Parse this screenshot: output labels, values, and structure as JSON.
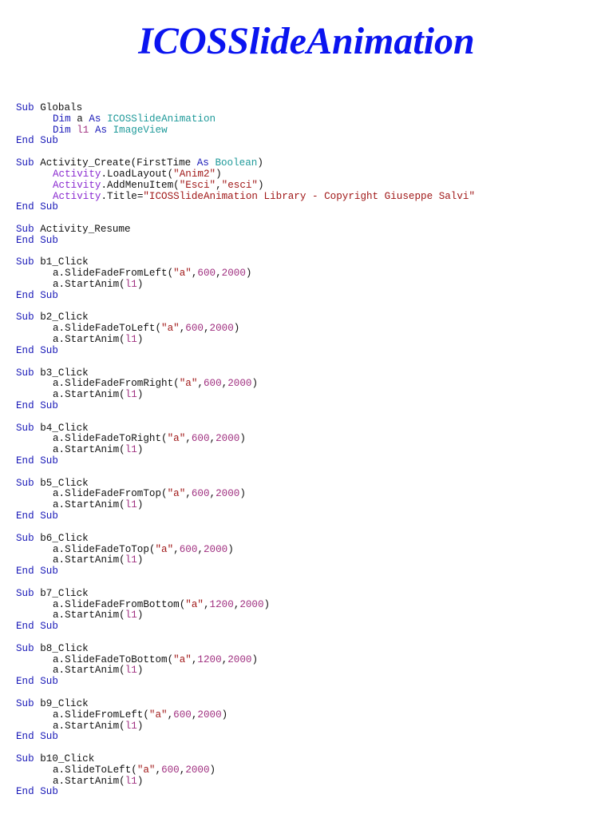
{
  "title": "ICOSSlideAnimation",
  "colors": {
    "title": "#0a14f0",
    "keyword": "#1a1ab8",
    "type": "#1f9a9a",
    "object": "#8a2ad0",
    "string": "#a01818",
    "number": "#a03080"
  },
  "code": [
    [
      0,
      [
        [
          "kw",
          "Sub"
        ],
        [
          "plain",
          " Globals"
        ]
      ]
    ],
    [
      1,
      [
        [
          "kw",
          "Dim"
        ],
        [
          "plain",
          " a "
        ],
        [
          "kw",
          "As"
        ],
        [
          "plain",
          " "
        ],
        [
          "type",
          "ICOSSlideAnimation"
        ]
      ]
    ],
    [
      1,
      [
        [
          "kw",
          "Dim"
        ],
        [
          "plain",
          " "
        ],
        [
          "num",
          "l1"
        ],
        [
          "plain",
          " "
        ],
        [
          "kw",
          "As"
        ],
        [
          "plain",
          " "
        ],
        [
          "type",
          "ImageView"
        ]
      ]
    ],
    [
      0,
      [
        [
          "kw",
          "End Sub"
        ]
      ]
    ],
    [
      0,
      []
    ],
    [
      0,
      [
        [
          "kw",
          "Sub"
        ],
        [
          "plain",
          " Activity_Create(FirstTime "
        ],
        [
          "kw",
          "As"
        ],
        [
          "plain",
          " "
        ],
        [
          "type",
          "Boolean"
        ],
        [
          "plain",
          ")"
        ]
      ]
    ],
    [
      1,
      [
        [
          "obj",
          "Activity"
        ],
        [
          "plain",
          ".LoadLayout("
        ],
        [
          "str",
          "\"Anim2\""
        ],
        [
          "plain",
          ")"
        ]
      ]
    ],
    [
      1,
      [
        [
          "obj",
          "Activity"
        ],
        [
          "plain",
          ".AddMenuItem("
        ],
        [
          "str",
          "\"Esci\""
        ],
        [
          "plain",
          ","
        ],
        [
          "str",
          "\"esci\""
        ],
        [
          "plain",
          ")"
        ]
      ]
    ],
    [
      1,
      [
        [
          "obj",
          "Activity"
        ],
        [
          "plain",
          ".Title="
        ],
        [
          "str",
          "\"ICOSSlideAnimation Library - Copyright Giuseppe Salvi\""
        ]
      ]
    ],
    [
      0,
      [
        [
          "kw",
          "End Sub"
        ]
      ]
    ],
    [
      0,
      []
    ],
    [
      0,
      [
        [
          "kw",
          "Sub"
        ],
        [
          "plain",
          " Activity_Resume"
        ]
      ]
    ],
    [
      0,
      [
        [
          "kw",
          "End Sub"
        ]
      ]
    ],
    [
      0,
      []
    ],
    [
      0,
      [
        [
          "kw",
          "Sub"
        ],
        [
          "plain",
          " b1_Click"
        ]
      ]
    ],
    [
      1,
      [
        [
          "plain",
          "a.SlideFadeFromLeft("
        ],
        [
          "str",
          "\"a\""
        ],
        [
          "plain",
          ","
        ],
        [
          "num",
          "600"
        ],
        [
          "plain",
          ","
        ],
        [
          "num",
          "2000"
        ],
        [
          "plain",
          ")"
        ]
      ]
    ],
    [
      1,
      [
        [
          "plain",
          "a.StartAnim("
        ],
        [
          "num",
          "l1"
        ],
        [
          "plain",
          ")"
        ]
      ]
    ],
    [
      0,
      [
        [
          "kw",
          "End Sub"
        ]
      ]
    ],
    [
      0,
      []
    ],
    [
      0,
      [
        [
          "kw",
          "Sub"
        ],
        [
          "plain",
          " b2_Click"
        ]
      ]
    ],
    [
      1,
      [
        [
          "plain",
          "a.SlideFadeToLeft("
        ],
        [
          "str",
          "\"a\""
        ],
        [
          "plain",
          ","
        ],
        [
          "num",
          "600"
        ],
        [
          "plain",
          ","
        ],
        [
          "num",
          "2000"
        ],
        [
          "plain",
          ")"
        ]
      ]
    ],
    [
      1,
      [
        [
          "plain",
          "a.StartAnim("
        ],
        [
          "num",
          "l1"
        ],
        [
          "plain",
          ")"
        ]
      ]
    ],
    [
      0,
      [
        [
          "kw",
          "End Sub"
        ]
      ]
    ],
    [
      0,
      []
    ],
    [
      0,
      [
        [
          "kw",
          "Sub"
        ],
        [
          "plain",
          " b3_Click"
        ]
      ]
    ],
    [
      1,
      [
        [
          "plain",
          "a.SlideFadeFromRight("
        ],
        [
          "str",
          "\"a\""
        ],
        [
          "plain",
          ","
        ],
        [
          "num",
          "600"
        ],
        [
          "plain",
          ","
        ],
        [
          "num",
          "2000"
        ],
        [
          "plain",
          ")"
        ]
      ]
    ],
    [
      1,
      [
        [
          "plain",
          "a.StartAnim("
        ],
        [
          "num",
          "l1"
        ],
        [
          "plain",
          ")"
        ]
      ]
    ],
    [
      0,
      [
        [
          "kw",
          "End Sub"
        ]
      ]
    ],
    [
      0,
      []
    ],
    [
      0,
      [
        [
          "kw",
          "Sub"
        ],
        [
          "plain",
          " b4_Click"
        ]
      ]
    ],
    [
      1,
      [
        [
          "plain",
          "a.SlideFadeToRight("
        ],
        [
          "str",
          "\"a\""
        ],
        [
          "plain",
          ","
        ],
        [
          "num",
          "600"
        ],
        [
          "plain",
          ","
        ],
        [
          "num",
          "2000"
        ],
        [
          "plain",
          ")"
        ]
      ]
    ],
    [
      1,
      [
        [
          "plain",
          "a.StartAnim("
        ],
        [
          "num",
          "l1"
        ],
        [
          "plain",
          ")"
        ]
      ]
    ],
    [
      0,
      [
        [
          "kw",
          "End Sub"
        ]
      ]
    ],
    [
      0,
      []
    ],
    [
      0,
      [
        [
          "kw",
          "Sub"
        ],
        [
          "plain",
          " b5_Click"
        ]
      ]
    ],
    [
      1,
      [
        [
          "plain",
          "a.SlideFadeFromTop("
        ],
        [
          "str",
          "\"a\""
        ],
        [
          "plain",
          ","
        ],
        [
          "num",
          "600"
        ],
        [
          "plain",
          ","
        ],
        [
          "num",
          "2000"
        ],
        [
          "plain",
          ")"
        ]
      ]
    ],
    [
      1,
      [
        [
          "plain",
          "a.StartAnim("
        ],
        [
          "num",
          "l1"
        ],
        [
          "plain",
          ")"
        ]
      ]
    ],
    [
      0,
      [
        [
          "kw",
          "End Sub"
        ]
      ]
    ],
    [
      0,
      []
    ],
    [
      0,
      [
        [
          "kw",
          "Sub"
        ],
        [
          "plain",
          " b6_Click"
        ]
      ]
    ],
    [
      1,
      [
        [
          "plain",
          "a.SlideFadeToTop("
        ],
        [
          "str",
          "\"a\""
        ],
        [
          "plain",
          ","
        ],
        [
          "num",
          "600"
        ],
        [
          "plain",
          ","
        ],
        [
          "num",
          "2000"
        ],
        [
          "plain",
          ")"
        ]
      ]
    ],
    [
      1,
      [
        [
          "plain",
          "a.StartAnim("
        ],
        [
          "num",
          "l1"
        ],
        [
          "plain",
          ")"
        ]
      ]
    ],
    [
      0,
      [
        [
          "kw",
          "End Sub"
        ]
      ]
    ],
    [
      0,
      []
    ],
    [
      0,
      [
        [
          "kw",
          "Sub"
        ],
        [
          "plain",
          " b7_Click"
        ]
      ]
    ],
    [
      1,
      [
        [
          "plain",
          "a.SlideFadeFromBottom("
        ],
        [
          "str",
          "\"a\""
        ],
        [
          "plain",
          ","
        ],
        [
          "num",
          "1200"
        ],
        [
          "plain",
          ","
        ],
        [
          "num",
          "2000"
        ],
        [
          "plain",
          ")"
        ]
      ]
    ],
    [
      1,
      [
        [
          "plain",
          "a.StartAnim("
        ],
        [
          "num",
          "l1"
        ],
        [
          "plain",
          ")"
        ]
      ]
    ],
    [
      0,
      [
        [
          "kw",
          "End Sub"
        ]
      ]
    ],
    [
      0,
      []
    ],
    [
      0,
      [
        [
          "kw",
          "Sub"
        ],
        [
          "plain",
          " b8_Click"
        ]
      ]
    ],
    [
      1,
      [
        [
          "plain",
          "a.SlideFadeToBottom("
        ],
        [
          "str",
          "\"a\""
        ],
        [
          "plain",
          ","
        ],
        [
          "num",
          "1200"
        ],
        [
          "plain",
          ","
        ],
        [
          "num",
          "2000"
        ],
        [
          "plain",
          ")"
        ]
      ]
    ],
    [
      1,
      [
        [
          "plain",
          "a.StartAnim("
        ],
        [
          "num",
          "l1"
        ],
        [
          "plain",
          ")"
        ]
      ]
    ],
    [
      0,
      [
        [
          "kw",
          "End Sub"
        ]
      ]
    ],
    [
      0,
      []
    ],
    [
      0,
      [
        [
          "kw",
          "Sub"
        ],
        [
          "plain",
          " b9_Click"
        ]
      ]
    ],
    [
      1,
      [
        [
          "plain",
          "a.SlideFromLeft("
        ],
        [
          "str",
          "\"a\""
        ],
        [
          "plain",
          ","
        ],
        [
          "num",
          "600"
        ],
        [
          "plain",
          ","
        ],
        [
          "num",
          "2000"
        ],
        [
          "plain",
          ")"
        ]
      ]
    ],
    [
      1,
      [
        [
          "plain",
          "a.StartAnim("
        ],
        [
          "num",
          "l1"
        ],
        [
          "plain",
          ")"
        ]
      ]
    ],
    [
      0,
      [
        [
          "kw",
          "End Sub"
        ]
      ]
    ],
    [
      0,
      []
    ],
    [
      0,
      [
        [
          "kw",
          "Sub"
        ],
        [
          "plain",
          " b10_Click"
        ]
      ]
    ],
    [
      1,
      [
        [
          "plain",
          "a.SlideToLeft("
        ],
        [
          "str",
          "\"a\""
        ],
        [
          "plain",
          ","
        ],
        [
          "num",
          "600"
        ],
        [
          "plain",
          ","
        ],
        [
          "num",
          "2000"
        ],
        [
          "plain",
          ")"
        ]
      ]
    ],
    [
      1,
      [
        [
          "plain",
          "a.StartAnim("
        ],
        [
          "num",
          "l1"
        ],
        [
          "plain",
          ")"
        ]
      ]
    ],
    [
      0,
      [
        [
          "kw",
          "End Sub"
        ]
      ]
    ]
  ]
}
